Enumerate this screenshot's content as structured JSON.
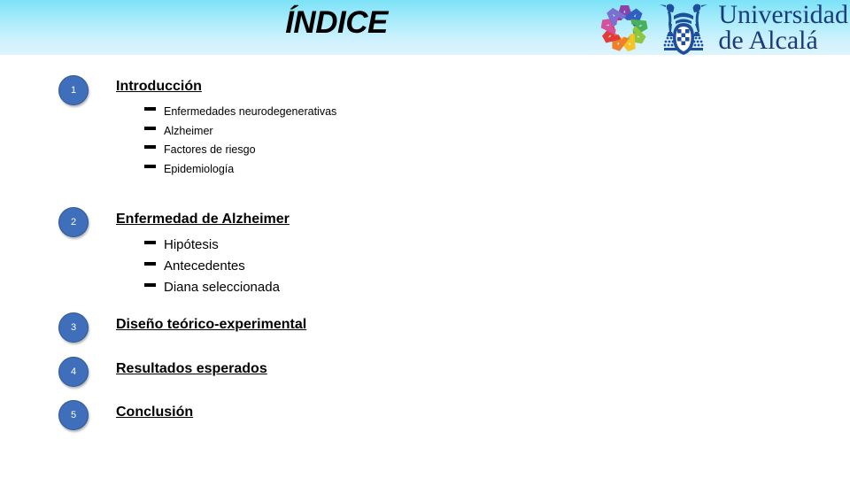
{
  "header": {
    "title": "ÍNDICE",
    "gradient_top": "#7ce2f7",
    "gradient_bottom": "#ddf4fe",
    "logo": {
      "rosette_icon": "colored-rosette-icon",
      "crest_icon": "storks-crest-icon",
      "wordmark_line1": "Universidad",
      "wordmark_line2": "de Alcalá",
      "wordmark_color": "#1b3c7a"
    }
  },
  "index": {
    "badge_color": "#3f6ebb",
    "sections": [
      {
        "number": "1",
        "heading": "Introducción",
        "subitems": [
          "Enfermedades neurodegenerativas",
          "Alzheimer",
          "Factores de riesgo",
          "Epidemiología"
        ]
      },
      {
        "number": "2",
        "heading": "Enfermedad de Alzheimer",
        "subitems": [
          "Hipótesis",
          "Antecedentes",
          "Diana seleccionada"
        ]
      },
      {
        "number": "3",
        "heading": "Diseño teórico-experimental",
        "subitems": []
      },
      {
        "number": "4",
        "heading": "Resultados esperados",
        "subitems": []
      },
      {
        "number": "5",
        "heading": "Conclusión",
        "subitems": []
      }
    ]
  }
}
